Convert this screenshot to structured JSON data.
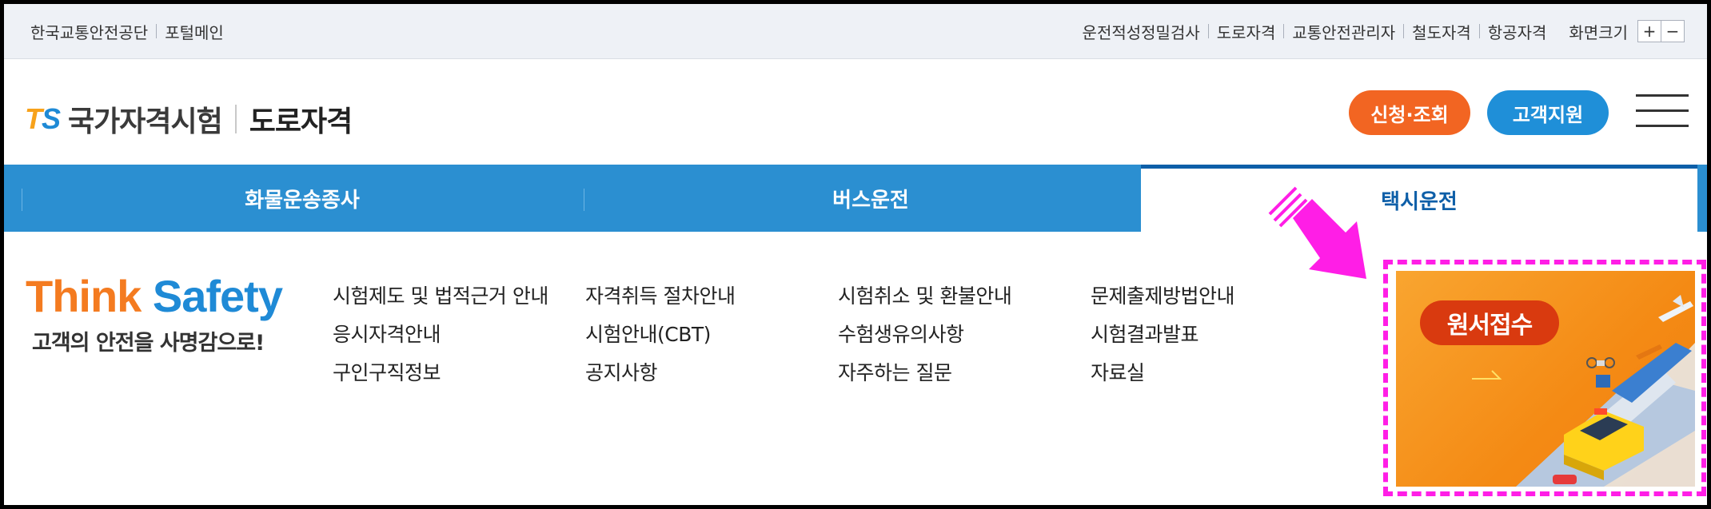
{
  "utility": {
    "left_links": [
      "한국교통안전공단",
      "포털메인"
    ],
    "right_links": [
      "운전적성정밀검사",
      "도로자격",
      "교통안전관리자",
      "철도자격",
      "항공자격"
    ],
    "zoom_label": "화면크기",
    "zoom_plus": "+",
    "zoom_minus": "−"
  },
  "header": {
    "logo_t": "T",
    "logo_s": "S",
    "logo_title": "국가자격시험",
    "logo_sub": "도로자격",
    "apply_button": "신청·조회",
    "support_button": "고객지원",
    "menu_icon": "hamburger-icon"
  },
  "tabs": [
    {
      "label": "화물운송종사",
      "active": false
    },
    {
      "label": "버스운전",
      "active": false
    },
    {
      "label": "택시운전",
      "active": true
    }
  ],
  "slogan": {
    "think": "Think",
    "safety": "Safety",
    "subtitle": "고객의 안전을 사명감으로!"
  },
  "menu": {
    "col1": [
      "시험제도 및 법적근거 안내",
      "응시자격안내",
      "구인구직정보"
    ],
    "col2": [
      "자격취득 절차안내",
      "시험안내(CBT)",
      "공지사항"
    ],
    "col3": [
      "시험취소 및 환불안내",
      "수험생유의사항",
      "자주하는 질문"
    ],
    "col4": [
      "문제출제방법안내",
      "시험결과발표",
      "자료실"
    ]
  },
  "banner": {
    "label": "원서접수"
  },
  "colors": {
    "tab_bg": "#2b8fd1",
    "orange": "#f26522",
    "blue": "#1f8fd8",
    "highlight": "#ff1ee6"
  }
}
